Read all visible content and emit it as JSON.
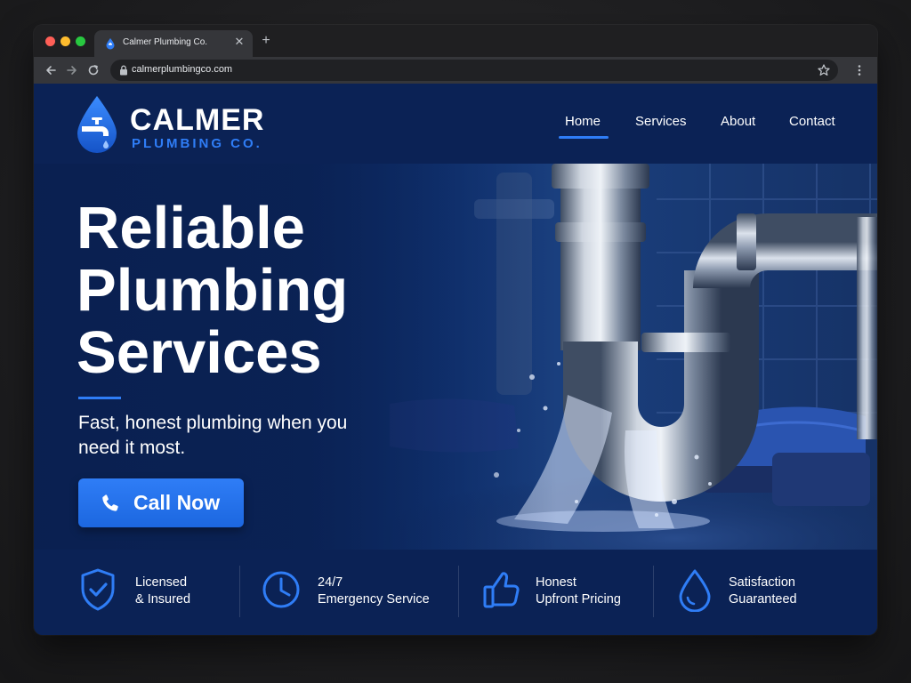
{
  "browser": {
    "tab_title": "Calmer Plumbing Co.",
    "url": "calmerplumbingco.com",
    "icons": {
      "favicon": "water-drop-icon",
      "close": "close-icon",
      "new_tab": "plus-icon",
      "back": "arrow-left-icon",
      "forward": "arrow-right-icon",
      "reload": "reload-icon",
      "lock": "lock-icon",
      "bookmark": "star-icon",
      "menu": "more-vertical-icon"
    }
  },
  "site": {
    "logo": {
      "name": "CALMER",
      "sub": "PLUMBING CO.",
      "icon": "water-drop-faucet-icon"
    },
    "nav": [
      {
        "label": "Home",
        "active": true
      },
      {
        "label": "Services",
        "active": false
      },
      {
        "label": "About",
        "active": false
      },
      {
        "label": "Contact",
        "active": false
      }
    ],
    "hero": {
      "title_lines": [
        "Reliable",
        "Plumbing",
        "Services"
      ],
      "subtitle": "Fast, honest plumbing when you need it most.",
      "cta": {
        "label": "Call Now",
        "icon": "phone-icon"
      }
    },
    "features": [
      {
        "icon": "shield-check-icon",
        "line1": "Licensed",
        "line2": "& Insured"
      },
      {
        "icon": "clock-icon",
        "line1": "24/7",
        "line2": "Emergency Service"
      },
      {
        "icon": "thumbs-up-icon",
        "line1": "Honest",
        "line2": "Upfront Pricing"
      },
      {
        "icon": "water-drop-icon",
        "line1": "Satisfaction",
        "line2": "Guaranteed"
      }
    ]
  },
  "colors": {
    "accent": "#2f7df6",
    "page_bg": "#0a1f4a",
    "header_bg": "#0b2255",
    "browser_bg": "#35363a"
  }
}
